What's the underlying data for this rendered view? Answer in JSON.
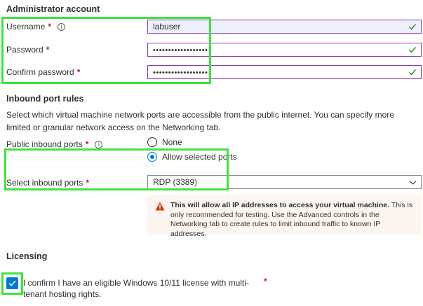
{
  "admin": {
    "title": "Administrator account",
    "username_label": "Username",
    "username_value": "labuser",
    "password_label": "Password",
    "password_value": "••••••••••••••••••",
    "confirm_label": "Confirm password",
    "confirm_value": "••••••••••••••••••",
    "required_mark": "*",
    "info_glyph": "i"
  },
  "inbound": {
    "title": "Inbound port rules",
    "description": "Select which virtual machine network ports are accessible from the public internet. You can specify more limited or granular network access on the Networking tab.",
    "public_label": "Public inbound ports",
    "option_none": "None",
    "option_allow": "Allow selected ports",
    "selected_option": "Allow selected ports",
    "select_label": "Select inbound ports",
    "select_value": "RDP (3389)",
    "warning_bold": "This will allow all IP addresses to access your virtual machine.",
    "warning_text": " This is only recommended for testing.  Use the Advanced controls in the Networking tab to create rules to limit inbound traffic to known IP addresses."
  },
  "licensing": {
    "title": "Licensing",
    "confirm_text": "I confirm I have an eligible Windows 10/11 license with multi-tenant hosting rights.",
    "checked": true
  },
  "colors": {
    "accent": "#0078d4",
    "required": "#a4262c",
    "valid_check": "#107c10",
    "warning_icon": "#d83b01",
    "highlight": "#3ee43e"
  },
  "icons": [
    "info-icon",
    "check-icon",
    "chevron-down-icon",
    "warning-icon",
    "checkbox-check-icon"
  ]
}
